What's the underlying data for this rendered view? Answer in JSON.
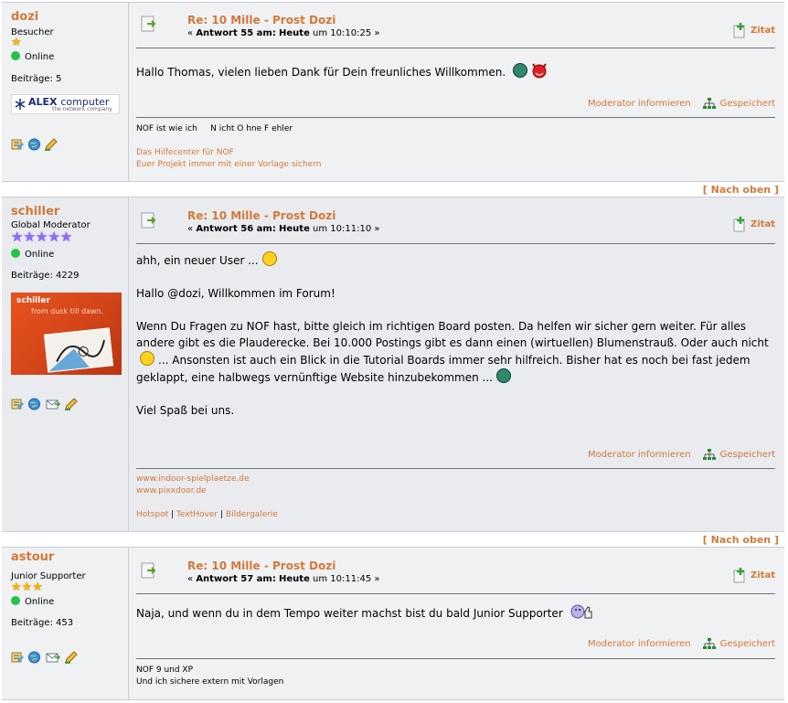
{
  "posts": [
    {
      "user": "dozi",
      "rank": "Besucher",
      "online": "Online",
      "post_count": "Beiträge: 5",
      "avatar_text": "ALEX",
      "avatar_text2": "computer",
      "avatar_sub": "the network company",
      "title": "Re: 10 Mille - Prost Dozi",
      "meta_pre": "«",
      "meta_bold": "Antwort 55 am:",
      "meta_today": "Heute",
      "meta_time": "um 10:10:25",
      "meta_post": "»",
      "quote": "Zitat",
      "body": [
        "Hallo Thomas, vielen lieben Dank für Dein freunliches Willkommen."
      ],
      "report": "Moderator informieren",
      "saved": "Gespeichert",
      "signature": [
        "NOF ist wie ich     N icht O hne F ehler"
      ],
      "sig_links": [
        "Das Hilfecenter für NOF",
        "Euer Projekt immer mit einer Vorlage sichern"
      ]
    },
    {
      "user": "schiller",
      "rank": "Global Moderator",
      "online": "Online",
      "post_count": "Beiträge: 4229",
      "avatar_text": "schiller",
      "avatar_sub": "from dusk till dawn.",
      "title": "Re: 10 Mille - Prost Dozi",
      "meta_pre": "«",
      "meta_bold": "Antwort 56 am:",
      "meta_today": "Heute",
      "meta_time": "um 10:11:10",
      "meta_post": "»",
      "quote": "Zitat",
      "body": [
        "ahh, ein neuer User ...",
        "Hallo @dozi, Willkommen im Forum!",
        "Wenn Du Fragen zu NOF hast, bitte gleich im richtigen Board posten. Da helfen wir sicher gern weiter. Für alles andere gibt es die Plauderecke. Bei 10.000 Postings gibt es dann einen (wirtuellen) Blumenstrauß. Oder auch nicht",
        "... Ansonsten ist auch ein Blick in die Tutorial Boards immer sehr hilfreich. Bisher hat es noch bei fast jedem geklappt, eine halbwegs vernünftige Website hinzubekommen ...",
        "Viel Spaß bei uns."
      ],
      "report": "Moderator informieren",
      "saved": "Gespeichert",
      "sig_links": [
        "www.indoor-spielplaetze.de",
        "www.pixxdoor.de"
      ],
      "sig_links2": [
        "Hotspot",
        "TextHover",
        "Bildergalerie"
      ]
    },
    {
      "user": "astour",
      "rank": "Junior Supporter",
      "online": "Online",
      "post_count": "Beiträge: 453",
      "title": "Re: 10 Mille - Prost Dozi",
      "meta_pre": "«",
      "meta_bold": "Antwort 57 am:",
      "meta_today": "Heute",
      "meta_time": "um 10:11:45",
      "meta_post": "»",
      "quote": "Zitat",
      "body": [
        "Naja, und wenn du in dem Tempo weiter machst bist du bald Junior Supporter"
      ],
      "report": "Moderator informieren",
      "saved": "Gespeichert",
      "signature": [
        "NOF 9 und XP",
        "Und ich sichere extern mit Vorlagen"
      ]
    }
  ],
  "nav": {
    "top_label": "[ Nach oben ]"
  },
  "colors": {
    "accent": "#d2793a",
    "bg_a": "#f0f1f3",
    "bg_b": "#e9ebef"
  },
  "icons": [
    "profile-icon",
    "www-icon",
    "pm-icon",
    "edit-icon",
    "quote-icon",
    "sitemap-icon",
    "post-icon"
  ]
}
